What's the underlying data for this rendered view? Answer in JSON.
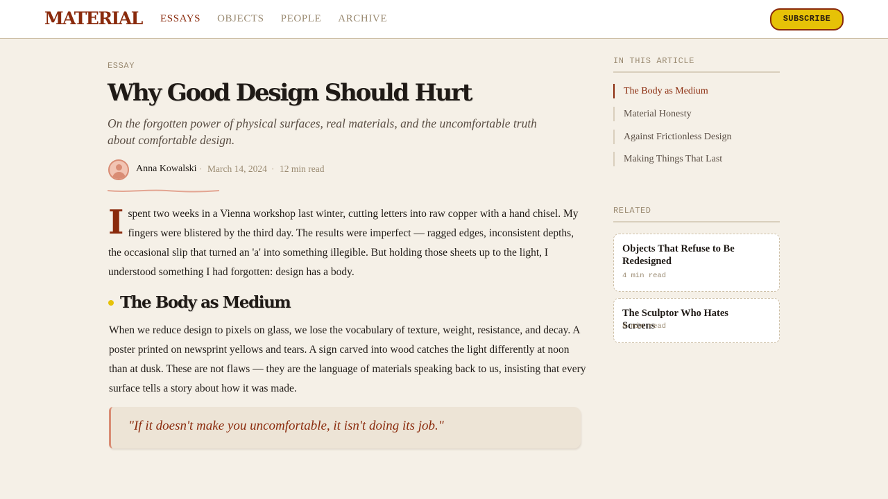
{
  "header": {
    "brand": "MATERIAL",
    "nav": [
      {
        "label": "ESSAYS",
        "active": true
      },
      {
        "label": "OBJECTS",
        "active": false
      },
      {
        "label": "PEOPLE",
        "active": false
      },
      {
        "label": "ARCHIVE",
        "active": false
      }
    ],
    "subscribe_label": "SUBSCRIBE"
  },
  "article": {
    "kicker": "ESSAY",
    "title": "Why Good Design Should Hurt",
    "subtitle": "On the forgotten power of physical surfaces, real materials, and the uncomfortable truth about comfortable design.",
    "author": "Anna Kowalski",
    "date": "March 14, 2024",
    "read_time": "12 min read",
    "separator": "·",
    "dropcap": "I",
    "paragraph1": "spent two weeks in a Vienna workshop last winter, cutting letters into raw copper with a hand chisel. My fingers were blistered by the third day. The results were imperfect — ragged edges, inconsistent depths, the occasional slip that turned an 'a' into something illegible. But holding those sheets up to the light, I understood something I had forgotten: design has a body.",
    "heading2": "The Body as Medium",
    "paragraph2": "When we reduce design to pixels on glass, we lose the vocabulary of texture, weight, resistance, and decay. A poster printed on newsprint yellows and tears. A sign carved into wood catches the light differently at noon than at dusk. These are not flaws — they are the language of materials speaking back to us, insisting that every surface tells a story about how it was made.",
    "pullquote": "\"If it doesn't make you uncomfortable, it isn't doing its job.\""
  },
  "sidebar": {
    "toc_heading": "IN THIS ARTICLE",
    "toc": [
      {
        "label": "The Body as Medium",
        "active": true
      },
      {
        "label": "Material Honesty",
        "active": false
      },
      {
        "label": "Against Frictionless Design",
        "active": false
      },
      {
        "label": "Making Things That Last",
        "active": false
      }
    ],
    "related_heading": "RELATED",
    "related": [
      {
        "title": "Objects That Refuse to Be Redesigned",
        "read_time": "4 min read"
      },
      {
        "title": "The Sculptor Who Hates Screens",
        "read_time": "8 min read"
      }
    ]
  },
  "colors": {
    "accent": "#8a2a0c",
    "highlight": "#e6c207",
    "background": "#f5f0e7",
    "muted": "#9a8a71",
    "avatar": "#d98c74"
  },
  "icons": {
    "avatar": "user-avatar-icon",
    "heading_marker": "dot-icon"
  }
}
